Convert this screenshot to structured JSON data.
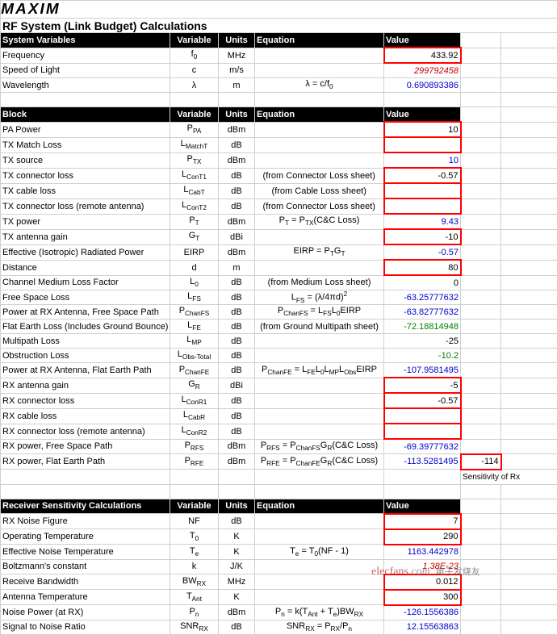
{
  "brand": "MAXIM",
  "title": "RF System (Link Budget) Calculations",
  "headers": {
    "sysvars": "System Variables",
    "variable": "Variable",
    "units": "Units",
    "equation": "Equation",
    "value": "Value",
    "block": "Block",
    "rxsens": "Receiver Sensitivity Calculations"
  },
  "sidecell": {
    "value": "-114",
    "label": "Sensitivity of Rx"
  },
  "watermark": {
    "site": "elecfans",
    "dotcom": ".com",
    "cn": "电子发烧友"
  },
  "sys": [
    {
      "label": "Frequency",
      "var_html": "f<span class=\"sub\">0</span>",
      "unit": "MHz",
      "eq": "",
      "val": "433.92",
      "cls": "",
      "box": true
    },
    {
      "label": "Speed of Light",
      "var_html": "c",
      "unit": "m/s",
      "eq": "",
      "val": "299792458",
      "cls": "red-italic",
      "box": false
    },
    {
      "label": "Wavelength",
      "var_html": "λ",
      "unit": "m",
      "eq_html": "λ = c/f<span class=\"sub\">0</span>",
      "val": "0.690893386",
      "cls": "blue",
      "box": false
    }
  ],
  "blk": [
    {
      "label": "PA Power",
      "var_html": "P<span class=\"sub\">PA</span>",
      "unit": "dBm",
      "eq": "",
      "val": "10",
      "cls": "",
      "box": true
    },
    {
      "label": "TX Match Loss",
      "var_html": "L<span class=\"sub\">MatchT</span>",
      "unit": "dB",
      "eq": "",
      "val": "",
      "cls": "",
      "box": true
    },
    {
      "label": "TX source",
      "var_html": "P<span class=\"sub\">TX</span>",
      "unit": "dBm",
      "eq": "",
      "val": "10",
      "cls": "blue",
      "box": false
    },
    {
      "label": "TX connector loss",
      "var_html": "L<span class=\"sub\">ConT1</span>",
      "unit": "dB",
      "eq": "(from Connector Loss sheet)",
      "val": "-0.57",
      "cls": "",
      "box": true
    },
    {
      "label": "TX cable loss",
      "var_html": "L<span class=\"sub\">CabT</span>",
      "unit": "dB",
      "eq": "(from Cable Loss sheet)",
      "val": "",
      "cls": "",
      "box": true
    },
    {
      "label": "TX connector loss (remote antenna)",
      "var_html": "L<span class=\"sub\">ConT2</span>",
      "unit": "dB",
      "eq": "(from Connector Loss sheet)",
      "val": "",
      "cls": "",
      "box": true
    },
    {
      "label": "TX power",
      "var_html": "P<span class=\"sub\">T</span>",
      "unit": "dBm",
      "eq_html": "P<span class=\"sub\">T</span> = P<span class=\"sub\">TX</span>(C&C Loss)",
      "val": "9.43",
      "cls": "blue",
      "box": false
    },
    {
      "label": "TX antenna gain",
      "var_html": "G<span class=\"sub\">T</span>",
      "unit": "dBi",
      "eq": "",
      "val": "-10",
      "cls": "",
      "box": true
    },
    {
      "label": "Effective (Isotropic) Radiated Power",
      "var_html": "EIRP",
      "unit": "dBm",
      "eq_html": "EIRP = P<span class=\"sub\">T</span>G<span class=\"sub\">T</span>",
      "val": "-0.57",
      "cls": "blue",
      "box": false
    },
    {
      "label": "Distance",
      "var_html": "d",
      "unit": "m",
      "eq": "",
      "val": "80",
      "cls": "",
      "box": true
    },
    {
      "label": "Channel Medium Loss Factor",
      "var_html": "L<span class=\"sub\">0</span>",
      "unit": "dB",
      "eq": "(from Medium Loss sheet)",
      "val": "0",
      "cls": "",
      "box": false
    },
    {
      "label": "Free Space Loss",
      "var_html": "L<span class=\"sub\">FS</span>",
      "unit": "dB",
      "eq_html": "L<span class=\"sub\">FS</span> = (λ/4πd)<span class=\"sup\">2</span>",
      "val": "-63.25777632",
      "cls": "blue",
      "box": false
    },
    {
      "label": "Power at RX Antenna, Free Space Path",
      "var_html": "P<span class=\"sub\">ChanFS</span>",
      "unit": "dB",
      "eq_html": "P<span class=\"sub\">ChanFS</span> = L<span class=\"sub\">FS</span>L<span class=\"sub\">0</span>EIRP",
      "val": "-63.82777632",
      "cls": "blue",
      "box": false
    },
    {
      "label": "Flat Earth Loss (Includes Ground Bounce)",
      "var_html": "L<span class=\"sub\">FE</span>",
      "unit": "dB",
      "eq": "(from Ground Multipath sheet)",
      "val": "-72.18814948",
      "cls": "green",
      "box": false
    },
    {
      "label": "Multipath Loss",
      "var_html": "L<span class=\"sub\">MP</span>",
      "unit": "dB",
      "eq": "",
      "val": "-25",
      "cls": "",
      "box": false
    },
    {
      "label": "Obstruction Loss",
      "var_html": "L<span class=\"sub\">Obs-Total</span>",
      "unit": "dB",
      "eq": "",
      "val": "-10.2",
      "cls": "green",
      "box": false
    },
    {
      "label": "Power at RX Antenna, Flat Earth Path",
      "var_html": "P<span class=\"sub\">ChanFE</span>",
      "unit": "dB",
      "eq_html": "P<span class=\"sub\">ChanFE</span> = L<span class=\"sub\">FE</span>L<span class=\"sub\">0</span>L<span class=\"sub\">MP</span>L<span class=\"sub\">Obs</span>EIRP",
      "val": "-107.9581495",
      "cls": "blue",
      "box": false
    },
    {
      "label": "RX antenna gain",
      "var_html": "G<span class=\"sub\">R</span>",
      "unit": "dBi",
      "eq": "",
      "val": "-5",
      "cls": "",
      "box": true
    },
    {
      "label": "RX connector loss",
      "var_html": "L<span class=\"sub\">ConR1</span>",
      "unit": "dB",
      "eq": "",
      "val": "-0.57",
      "cls": "",
      "box": true
    },
    {
      "label": "RX cable loss",
      "var_html": "L<span class=\"sub\">CabR</span>",
      "unit": "dB",
      "eq": "",
      "val": "",
      "cls": "",
      "box": true
    },
    {
      "label": "RX connector loss (remote antenna)",
      "var_html": "L<span class=\"sub\">ConR2</span>",
      "unit": "dB",
      "eq": "",
      "val": "",
      "cls": "",
      "box": true
    },
    {
      "label": "RX power, Free Space Path",
      "var_html": "P<span class=\"sub\">RFS</span>",
      "unit": "dBm",
      "eq_html": "P<span class=\"sub\">RFS</span> = P<span class=\"sub\">ChanFS</span>G<span class=\"sub\">R</span>(C&C Loss)",
      "val": "-69.39777632",
      "cls": "blue",
      "box": false
    },
    {
      "label": "RX power, Flat Earth Path",
      "var_html": "P<span class=\"sub\">RFE</span>",
      "unit": "dBm",
      "eq_html": "P<span class=\"sub\">RFE</span> = P<span class=\"sub\">ChanFE</span>G<span class=\"sub\">R</span>(C&C Loss)",
      "val": "-113.5281495",
      "cls": "blue",
      "box": false
    }
  ],
  "rxs": [
    {
      "label": "RX Noise Figure",
      "var_html": "NF",
      "unit": "dB",
      "eq": "",
      "val": "7",
      "cls": "",
      "box": true
    },
    {
      "label": "Operating Temperature",
      "var_html": "T<span class=\"sub\">0</span>",
      "unit": "K",
      "eq": "",
      "val": "290",
      "cls": "",
      "box": true
    },
    {
      "label": "Effective Noise Temperature",
      "var_html": "T<span class=\"sub\">e</span>",
      "unit": "K",
      "eq_html": "T<span class=\"sub\">e</span> = T<span class=\"sub\">0</span>(NF - 1)",
      "val": "1163.442978",
      "cls": "blue",
      "box": false
    },
    {
      "label": "Boltzmann's constant",
      "var_html": "k",
      "unit": "J/K",
      "eq": "",
      "val": "1.38E-23",
      "cls": "red-italic",
      "box": false
    },
    {
      "label": "Receive Bandwidth",
      "var_html": "BW<span class=\"sub\">RX</span>",
      "unit": "MHz",
      "eq": "",
      "val": "0.012",
      "cls": "",
      "box": true
    },
    {
      "label": "Antenna Temperature",
      "var_html": "T<span class=\"sub\">Ant</span>",
      "unit": "K",
      "eq": "",
      "val": "300",
      "cls": "",
      "box": true
    },
    {
      "label": "Noise Power (at RX)",
      "var_html": "P<span class=\"sub\">n</span>",
      "unit": "dBm",
      "eq_html": "P<span class=\"sub\">n</span> = k(T<span class=\"sub\">Ant</span> + T<span class=\"sub\">e</span>)BW<span class=\"sub\">RX</span>",
      "val": "-126.1556386",
      "cls": "blue",
      "box": false
    },
    {
      "label": "Signal to Noise Ratio",
      "var_html": "SNR<span class=\"sub\">RX</span>",
      "unit": "dB",
      "eq_html": "SNR<span class=\"sub\">RX</span> = P<span class=\"sub\">RX</span>/P<span class=\"sub\">n</span>",
      "val": "12.15563863",
      "cls": "blue",
      "box": false
    }
  ]
}
